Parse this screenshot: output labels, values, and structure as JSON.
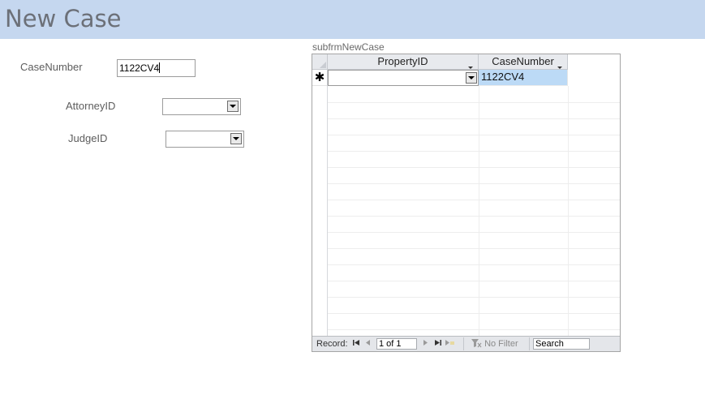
{
  "form": {
    "title": "New Case",
    "fields": {
      "case_number_label": "CaseNumber",
      "case_number_value": "1122CV4",
      "attorney_label": "AttorneyID",
      "attorney_value": "",
      "judge_label": "JudgeID",
      "judge_value": ""
    }
  },
  "subform": {
    "label": "subfrmNewCase",
    "columns": [
      "PropertyID",
      "CaseNumber"
    ],
    "new_record_marker": "✱",
    "rows": [
      {
        "property_id": "",
        "case_number": "1122CV4"
      }
    ]
  },
  "navigation": {
    "record_label": "Record:",
    "position": "1 of 1",
    "filter_label": "No Filter",
    "search_label": "Search"
  },
  "colors": {
    "header_band": "#c5d7ef",
    "selected_cell": "#bcdaf6"
  }
}
